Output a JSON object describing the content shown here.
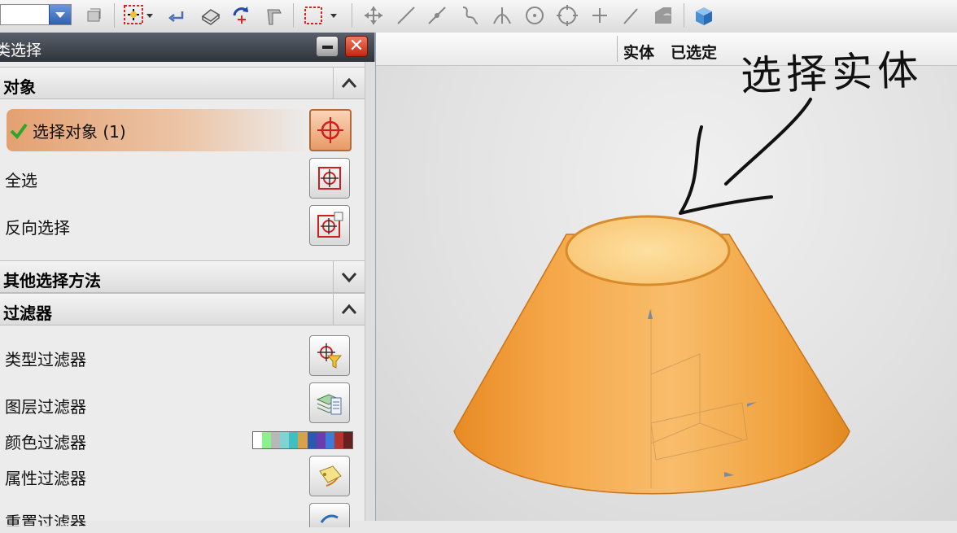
{
  "toolbar": {
    "combo_value": "",
    "icons": [
      "layer-select-icon",
      "snap-point-icon",
      "undo-arrow-icon",
      "view-orient-icon",
      "rotate-icon",
      "tool-icon",
      "box-select-icon",
      "move-icon",
      "line-icon",
      "point-line-icon",
      "curve-icon",
      "intersection-icon",
      "circle-icon",
      "circle-center-icon",
      "plus-icon",
      "slash-icon",
      "shape-icon",
      "cube-icon"
    ]
  },
  "viewport": {
    "header_left": "实体",
    "header_right": "已选定",
    "annotation": "选择实体",
    "model_color": "#f2a640"
  },
  "dialog": {
    "title": "类选择",
    "sections": {
      "objects": "对象",
      "other_methods": "其他选择方法",
      "filters": "过滤器"
    },
    "rows": {
      "select_object": "选择对象 (1)",
      "select_all": "全选",
      "invert_selection": "反向选择",
      "type_filter": "类型过滤器",
      "layer_filter": "图层过滤器",
      "color_filter": "颜色过滤器",
      "attribute_filter": "属性过滤器",
      "reset_filter": "重置过滤器"
    },
    "color_palette": [
      "#ffffff",
      "#8cf08c",
      "#b8b8b8",
      "#7fd3d3",
      "#3fc0c0",
      "#d9a24a",
      "#2b58b0",
      "#6a3cb0",
      "#3d7bd6",
      "#b6342e",
      "#6a1f1f"
    ]
  }
}
